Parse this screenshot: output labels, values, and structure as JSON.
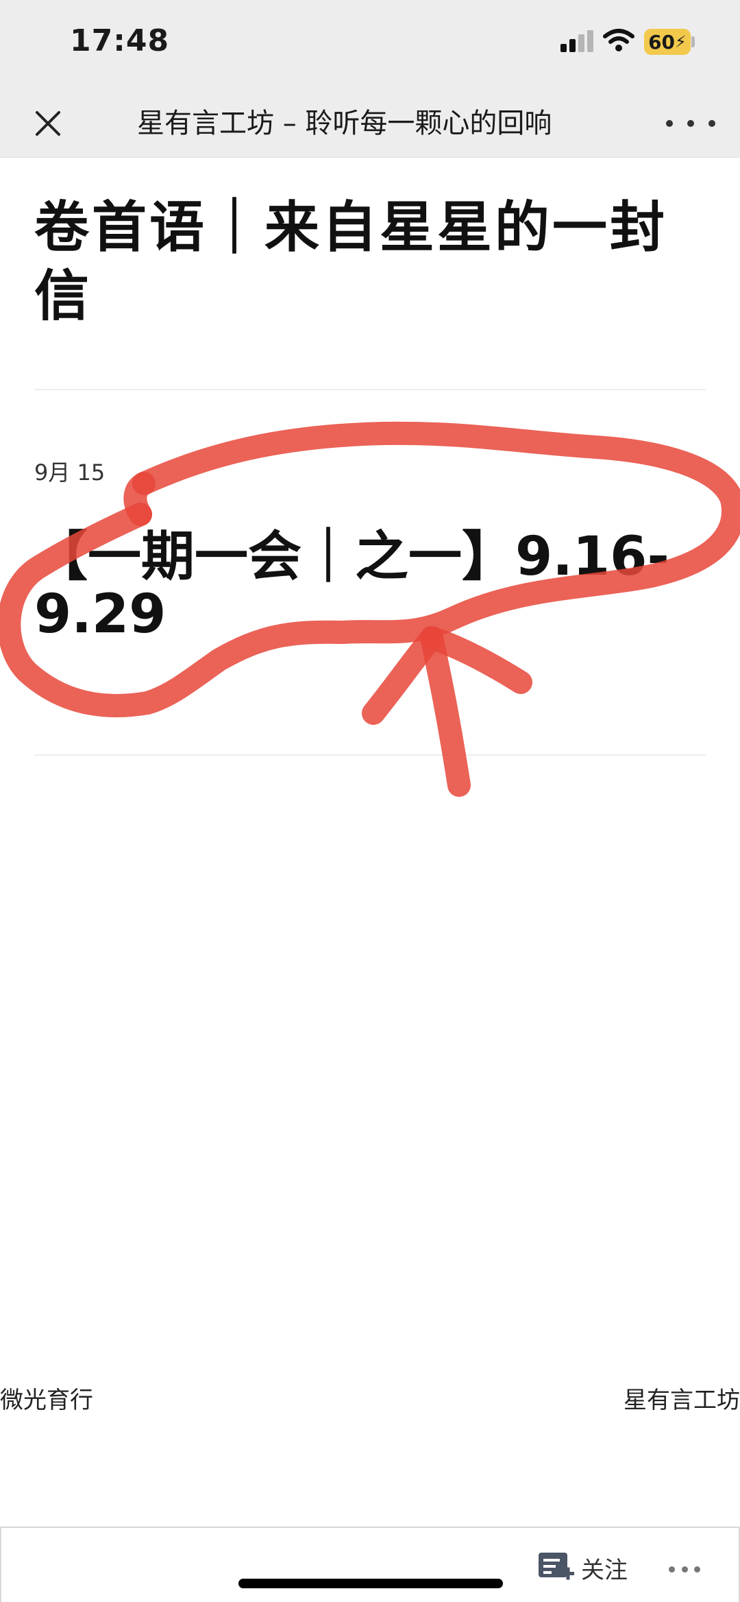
{
  "status_bar": {
    "time": "17:48",
    "battery_level": "60",
    "icons": [
      "cellular-signal-icon",
      "wifi-icon",
      "battery-charging-icon"
    ]
  },
  "nav": {
    "title": "星有言工坊 – 聆听每一颗心的回响",
    "close_icon": "close-icon",
    "more_icon": "more-icon"
  },
  "article": {
    "title": "卷首语｜来自星星的一封信"
  },
  "post": {
    "date": "9月 15",
    "title": "【一期一会｜之一】9.16-9.29"
  },
  "annotation": {
    "color": "#e8463a",
    "shape": "hand-drawn ellipse with arrow pointing up"
  },
  "footer": {
    "left_text": "微光育行",
    "right_text": "星有言工坊"
  },
  "bottom_bar": {
    "follow_label": "关注",
    "follow_icon": "follow-icon",
    "more_icon": "more-icon"
  },
  "colors": {
    "header_bg": "#ededed",
    "annotation_red": "#e8463a",
    "battery_yellow": "#f2c94c"
  }
}
